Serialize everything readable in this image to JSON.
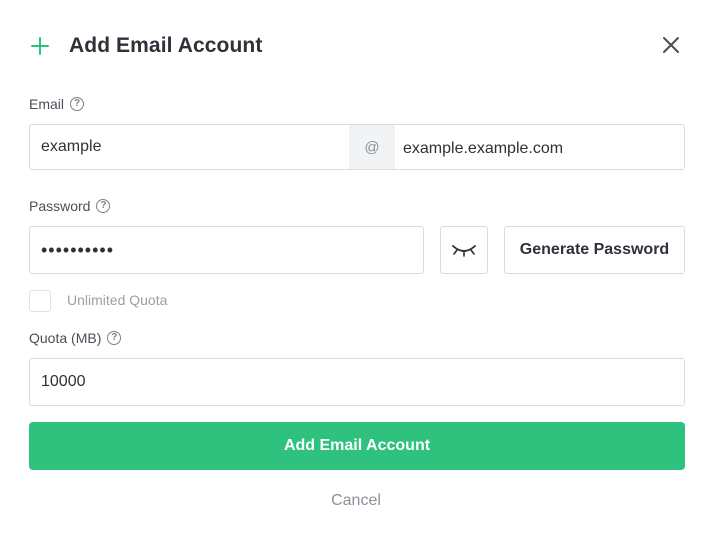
{
  "dialog": {
    "title": "Add Email Account",
    "close_icon": "close-icon",
    "title_icon": "plus-icon"
  },
  "email": {
    "label": "Email",
    "help_icon": "?",
    "local_value": "example",
    "at_symbol": "@",
    "domain_value": "example.example.com"
  },
  "password": {
    "label": "Password",
    "help_icon": "?",
    "masked_value": "••••••••••",
    "toggle_icon": "eye-closed-icon",
    "generate_label": "Generate Password"
  },
  "unlimited_quota": {
    "label": "Unlimited Quota",
    "checked": false
  },
  "quota": {
    "label": "Quota (MB)",
    "help_icon": "?",
    "value": "10000"
  },
  "actions": {
    "submit_label": "Add Email Account",
    "cancel_label": "Cancel"
  },
  "colors": {
    "accent": "#2ec27e",
    "border": "#d9dce1",
    "muted_text": "#8b9099"
  }
}
